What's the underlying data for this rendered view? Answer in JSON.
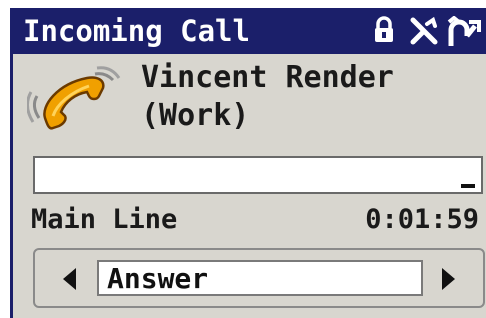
{
  "title_bar": {
    "title": "Incoming Call",
    "icons": [
      "lock-icon",
      "signal-off-icon",
      "call-forward-icon"
    ]
  },
  "caller": {
    "name": "Vincent Render",
    "type": "(Work)",
    "icon": "ringing-phone-icon"
  },
  "number_field": {
    "value": ""
  },
  "status": {
    "line": "Main Line",
    "duration": "0:01:59"
  },
  "action_bar": {
    "selected": "Answer",
    "left_icon": "arrow-left-icon",
    "right_icon": "arrow-right-icon"
  },
  "colors": {
    "title_bar": "#1b1f6a",
    "screen_bg": "#d8d6cf",
    "handset": "#f0a000"
  }
}
